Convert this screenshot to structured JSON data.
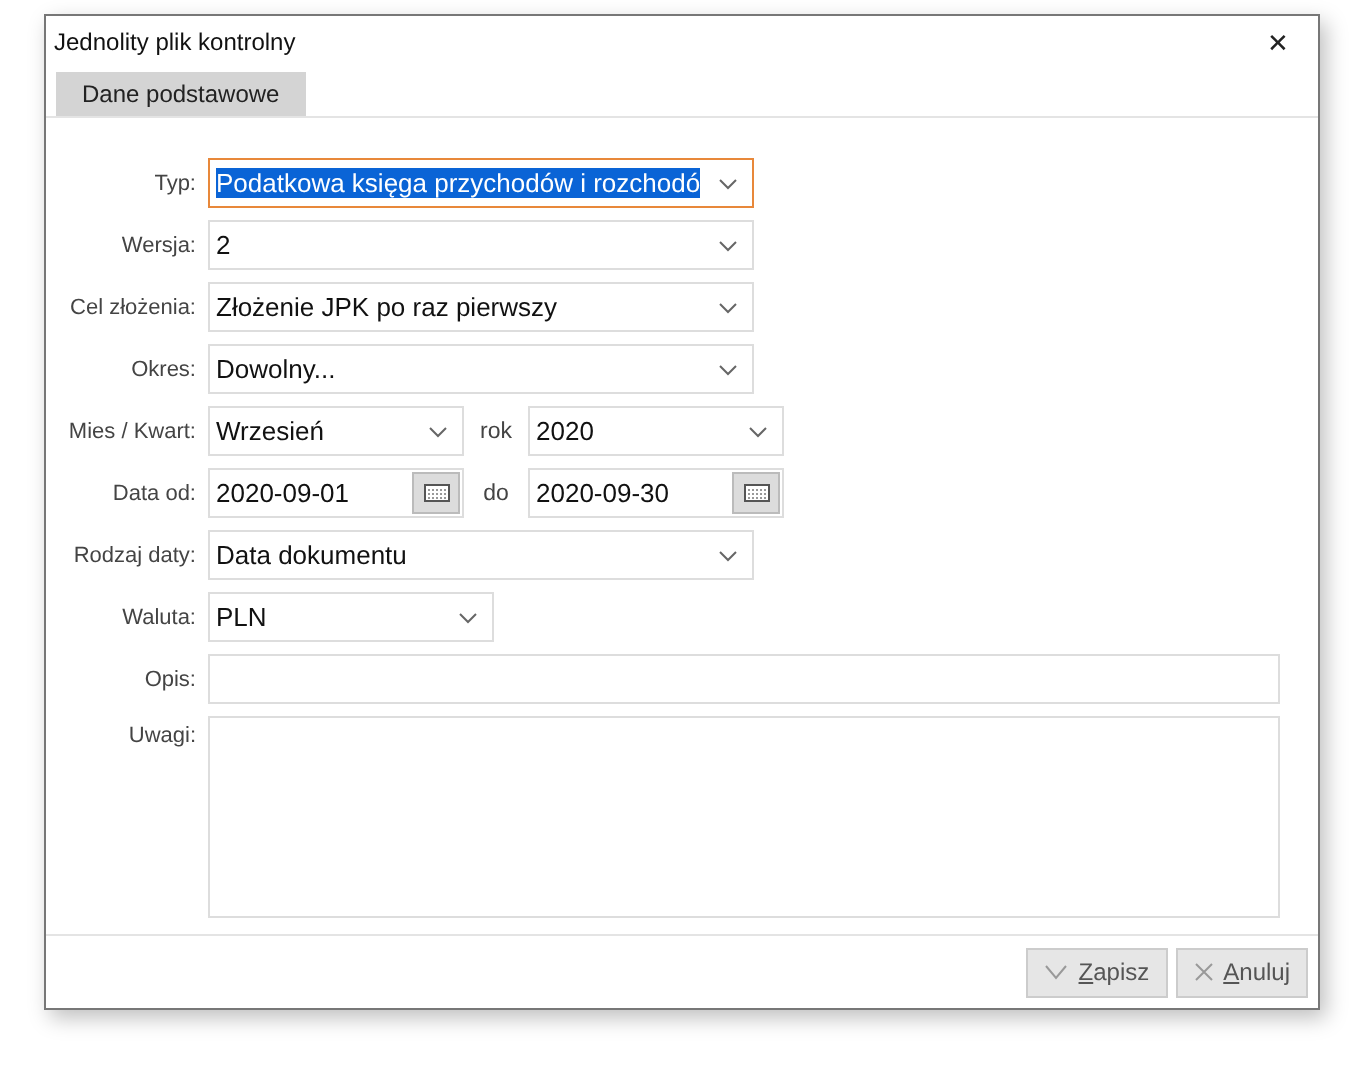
{
  "window": {
    "title": "Jednolity plik kontrolny",
    "close": "✕"
  },
  "tabs": [
    {
      "label": "Dane podstawowe",
      "selected": true
    }
  ],
  "rows": [
    {
      "label": "Typ:",
      "kind": "combo",
      "value": "Podatkowa księga przychodów i rozchodó",
      "focused": true
    },
    {
      "label": "Wersja:",
      "kind": "combo",
      "value": "2",
      "focused": false
    },
    {
      "label": "Cel złożenia:",
      "kind": "combo",
      "value": "Złożenie JPK po raz pierwszy",
      "focused": false
    },
    {
      "label": "Okres:",
      "kind": "combo",
      "value": "Dowolny...",
      "focused": false
    },
    {
      "label": "Mies / Kwart:",
      "kind": "combo_pair",
      "value": "Wrzesień",
      "second_label": "rok",
      "second_value": "2020",
      "focused": false
    },
    {
      "label": "Data od:",
      "kind": "date_pair",
      "value": "2020-09-01",
      "second_label": "do",
      "second_value": "2020-09-30",
      "focused": false
    },
    {
      "label": "Rodzaj daty:",
      "kind": "combo",
      "value": "Data dokumentu",
      "focused": false
    },
    {
      "label": "Waluta:",
      "kind": "combo_short",
      "value": "PLN",
      "focused": false
    },
    {
      "label": "Opis:",
      "kind": "text",
      "focused": false
    },
    {
      "label": "Uwagi:",
      "kind": "textarea",
      "focused": false
    }
  ],
  "buttons": [
    {
      "label": "Zapisz",
      "kind": "save",
      "first_underlined": true,
      "disabled": true
    },
    {
      "label": "Anuluj",
      "kind": "cancel",
      "first_underlined": true,
      "disabled": true
    }
  ]
}
